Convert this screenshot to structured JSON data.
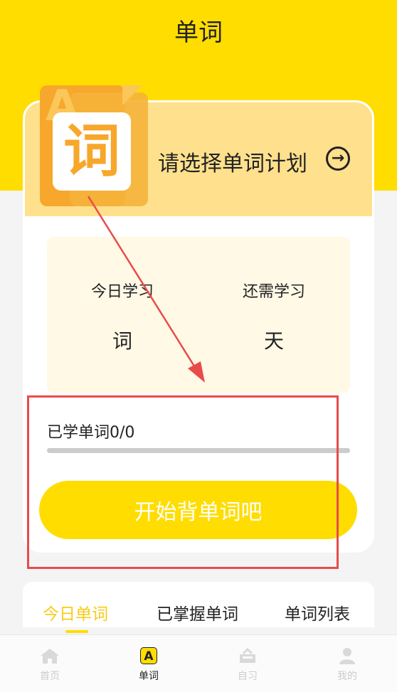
{
  "header": {
    "title": "单词"
  },
  "plan": {
    "icon_letter": "A",
    "icon_char": "词",
    "select_text": "请选择单词计划"
  },
  "stats": {
    "today_label": "今日学习",
    "today_value": "词",
    "remain_label": "还需学习",
    "remain_value": "天"
  },
  "progress": {
    "label": "已学单词0/0",
    "fraction": 0
  },
  "start_button": {
    "label": "开始背单词吧"
  },
  "tabs": [
    {
      "label": "今日单词",
      "active": true
    },
    {
      "label": "已掌握单词",
      "active": false
    },
    {
      "label": "单词列表",
      "active": false
    }
  ],
  "bottom_nav": [
    {
      "label": "首页",
      "icon": "home-icon"
    },
    {
      "label": "单词",
      "icon": "words-icon",
      "badge": "A"
    },
    {
      "label": "自习",
      "icon": "study-icon"
    },
    {
      "label": "我的",
      "icon": "user-icon"
    }
  ],
  "colors": {
    "brand": "#FFDD00",
    "accent": "#F7A72B",
    "annotation": "#E94B4B"
  }
}
